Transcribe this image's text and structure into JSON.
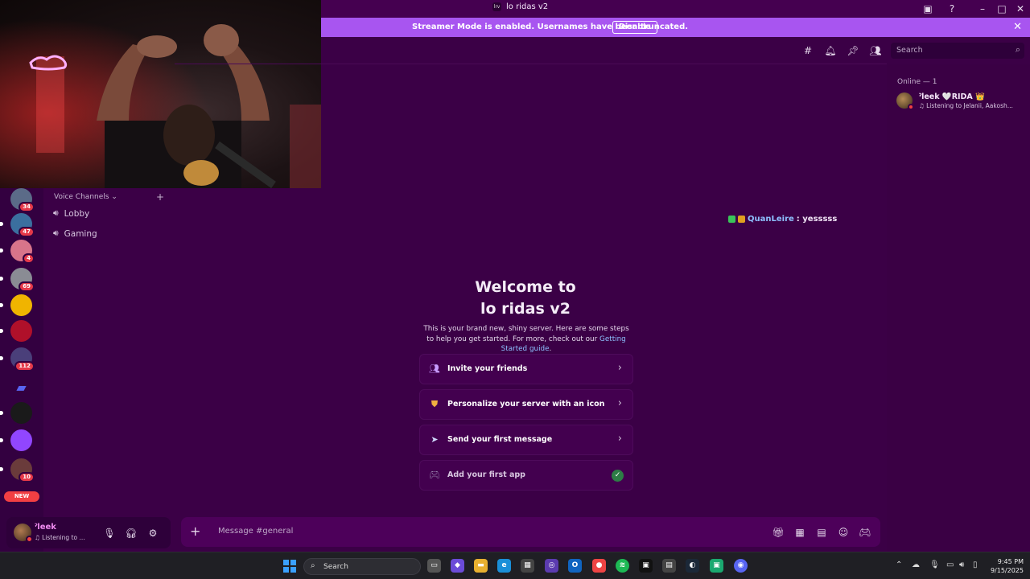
{
  "window": {
    "title": "lo ridas v2",
    "server_abbrev": "lrv"
  },
  "banner": {
    "message": "Streamer Mode is enabled. Usernames have been truncated.",
    "button": "Disable"
  },
  "guilds": [
    {
      "badge": "34",
      "color": "#5b6b88"
    },
    {
      "badge": "47",
      "color": "#3b6f9f"
    },
    {
      "badge": "4",
      "color": "#d8748a"
    },
    {
      "badge": "69",
      "color": "#8a8c94"
    },
    {
      "badge": "",
      "color": "#f0b400"
    },
    {
      "badge": "",
      "color": "#b0102a"
    },
    {
      "badge": "112",
      "color": "#4a3f7a"
    },
    {
      "badge": "",
      "color": "#5865f2"
    },
    {
      "badge": "",
      "color": "#1a1a1a"
    },
    {
      "badge": "",
      "color": "#9146ff"
    },
    {
      "badge": "10",
      "color": "#6a3b3b"
    }
  ],
  "guild_new_label": "NEW",
  "channels": {
    "category": "Voice Channels",
    "voice": [
      "Lobby",
      "Gaming"
    ]
  },
  "user_panel": {
    "name": "ˀleek",
    "status": "Listening to ..."
  },
  "header": {
    "search_placeholder": "Search"
  },
  "members": {
    "header": "Online — 1",
    "list": [
      {
        "name": "ˀleek 🤍RIDA 👑",
        "activity": "Listening to Jelanii, Aakosh..."
      }
    ]
  },
  "overlay_message": {
    "user": "QuanLeire",
    "text": ": yesssss"
  },
  "welcome": {
    "title_line1": "Welcome to",
    "title_line2": "lo ridas v2",
    "desc": "This is your brand new, shiny server. Here are some steps to help you get started. For more, check out our ",
    "link": "Getting Started guide",
    "desc_end": ".",
    "steps": [
      {
        "label": "Invite your friends",
        "done": false
      },
      {
        "label": "Personalize your server with an icon",
        "done": false
      },
      {
        "label": "Send your first message",
        "done": false
      },
      {
        "label": "Add your first app",
        "done": true
      }
    ]
  },
  "composer": {
    "placeholder": "Message #general"
  },
  "taskbar": {
    "search_placeholder": "Search",
    "time": "9:45 PM",
    "date": "9/15/2025"
  },
  "colors": {
    "accent": "#a855f0",
    "background": "#3b0046",
    "link": "#8ec1ff",
    "danger": "#f23f43"
  }
}
